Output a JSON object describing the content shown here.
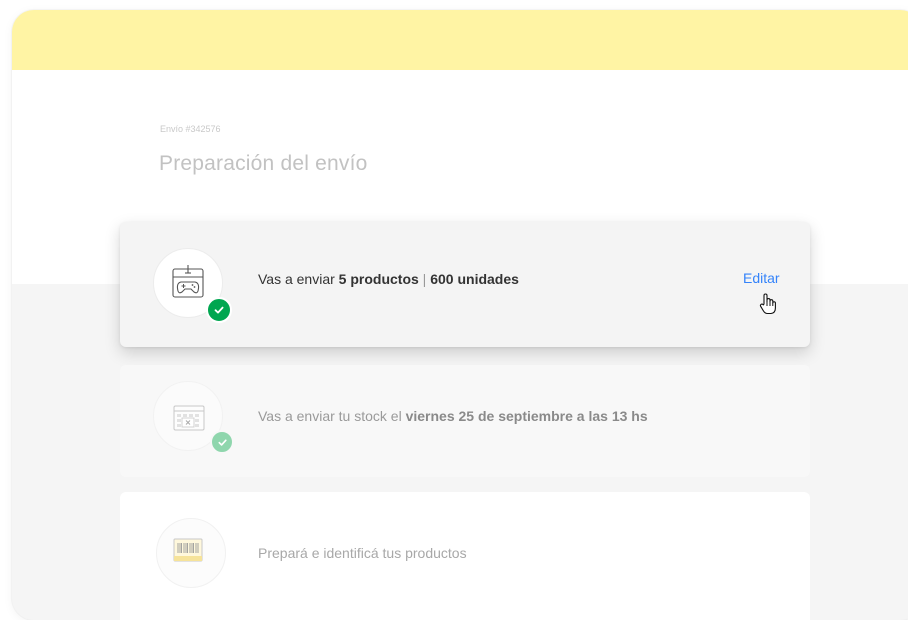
{
  "header": {
    "shipment_id": "Envío #342576",
    "title": "Preparación del envío"
  },
  "steps": [
    {
      "text_prefix": "Vas a enviar ",
      "products": "5 productos",
      "separator": " | ",
      "units": "600 unidades",
      "action_label": "Editar",
      "status": "completed",
      "icon": "gamepad-box-icon"
    },
    {
      "text_prefix": "Vas a enviar tu stock el ",
      "date": "viernes 25 de septiembre a las 13 hs",
      "status": "completed",
      "icon": "calendar-icon"
    },
    {
      "text": "Prepará e identificá tus productos",
      "status": "pending",
      "icon": "barcode-label-icon"
    }
  ],
  "colors": {
    "yellow": "#fff4a4",
    "accent": "#3483fa",
    "success": "#00a650"
  }
}
